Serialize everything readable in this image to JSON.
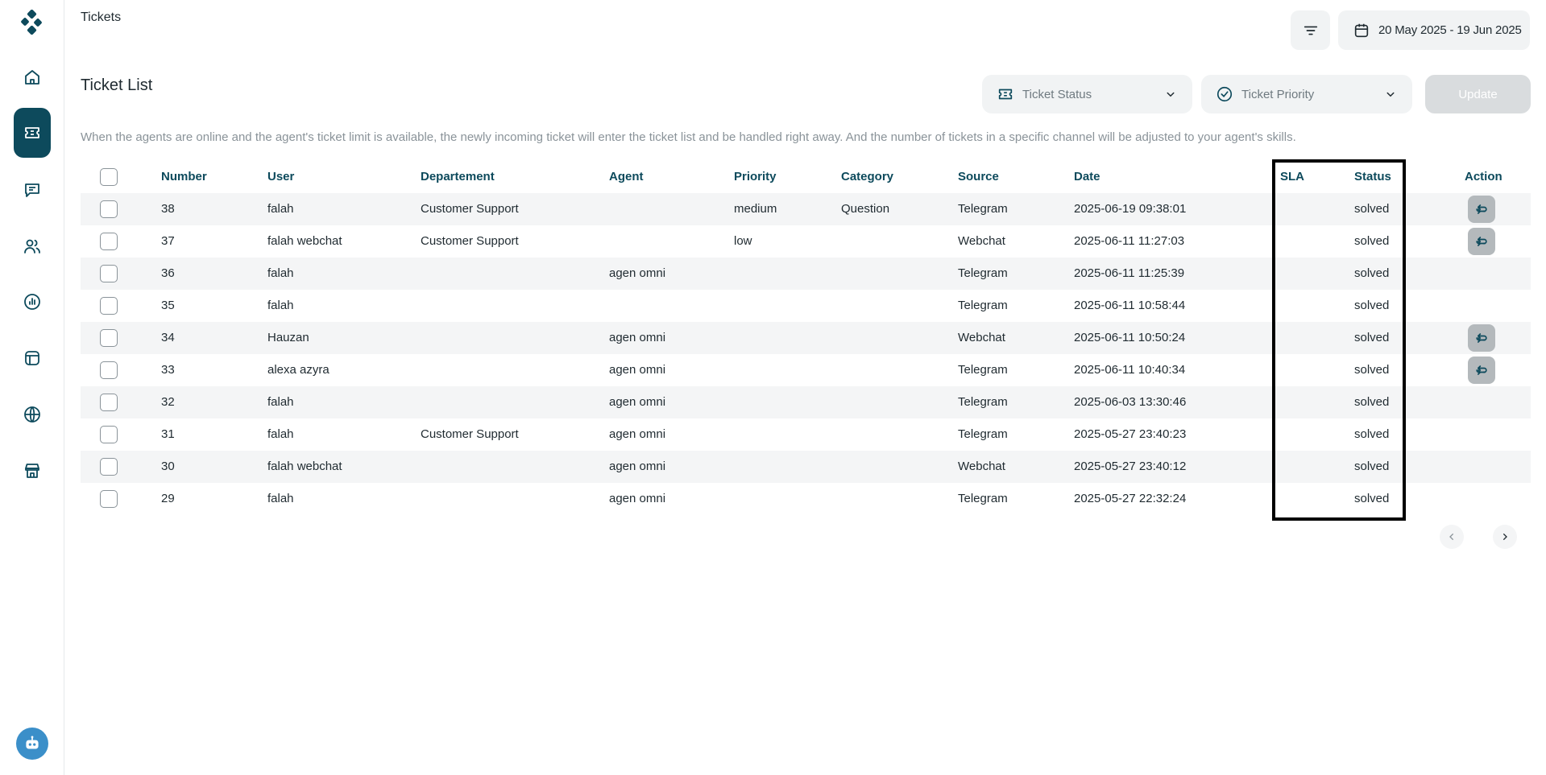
{
  "header": {
    "title": "Tickets",
    "date_range": "20 May 2025 - 19 Jun 2025"
  },
  "toolbar": {
    "list_title": "Ticket List",
    "status_placeholder": "Ticket Status",
    "priority_placeholder": "Ticket Priority",
    "update_label": "Update"
  },
  "description": "When the agents are online and the agent's ticket limit is available, the newly incoming ticket will enter the ticket list and be handled right away. And the number of tickets in a specific channel will be adjusted to your agent's skills.",
  "table": {
    "columns": {
      "number": "Number",
      "user": "User",
      "department": "Departement",
      "agent": "Agent",
      "priority": "Priority",
      "category": "Category",
      "source": "Source",
      "date": "Date",
      "sla": "SLA",
      "status": "Status",
      "action": "Action"
    },
    "rows": [
      {
        "number": "38",
        "user": "falah",
        "department": "Customer Support",
        "agent": "",
        "priority": "medium",
        "category": "Question",
        "source": "Telegram",
        "date": "2025-06-19 09:38:01",
        "sla": "",
        "status": "solved",
        "action": true
      },
      {
        "number": "37",
        "user": "falah webchat",
        "department": "Customer Support",
        "agent": "",
        "priority": "low",
        "category": "",
        "source": "Webchat",
        "date": "2025-06-11 11:27:03",
        "sla": "",
        "status": "solved",
        "action": true
      },
      {
        "number": "36",
        "user": "falah",
        "department": "",
        "agent": "agen omni",
        "priority": "",
        "category": "",
        "source": "Telegram",
        "date": "2025-06-11 11:25:39",
        "sla": "",
        "status": "solved",
        "action": false
      },
      {
        "number": "35",
        "user": "falah",
        "department": "",
        "agent": "",
        "priority": "",
        "category": "",
        "source": "Telegram",
        "date": "2025-06-11 10:58:44",
        "sla": "",
        "status": "solved",
        "action": false
      },
      {
        "number": "34",
        "user": "Hauzan",
        "department": "",
        "agent": "agen omni",
        "priority": "",
        "category": "",
        "source": "Webchat",
        "date": "2025-06-11 10:50:24",
        "sla": "",
        "status": "solved",
        "action": true
      },
      {
        "number": "33",
        "user": "alexa azyra",
        "department": "",
        "agent": "agen omni",
        "priority": "",
        "category": "",
        "source": "Telegram",
        "date": "2025-06-11 10:40:34",
        "sla": "",
        "status": "solved",
        "action": true
      },
      {
        "number": "32",
        "user": "falah",
        "department": "",
        "agent": "agen omni",
        "priority": "",
        "category": "",
        "source": "Telegram",
        "date": "2025-06-03 13:30:46",
        "sla": "",
        "status": "solved",
        "action": false
      },
      {
        "number": "31",
        "user": "falah",
        "department": "Customer Support",
        "agent": "agen omni",
        "priority": "",
        "category": "",
        "source": "Telegram",
        "date": "2025-05-27 23:40:23",
        "sla": "",
        "status": "solved",
        "action": false
      },
      {
        "number": "30",
        "user": "falah webchat",
        "department": "",
        "agent": "agen omni",
        "priority": "",
        "category": "",
        "source": "Webchat",
        "date": "2025-05-27 23:40:12",
        "sla": "",
        "status": "solved",
        "action": false
      },
      {
        "number": "29",
        "user": "falah",
        "department": "",
        "agent": "agen omni",
        "priority": "",
        "category": "",
        "source": "Telegram",
        "date": "2025-05-27 22:32:24",
        "sla": "",
        "status": "solved",
        "action": false
      }
    ]
  },
  "colors": {
    "accent": "#0d4a5c",
    "highlight_box": "#000000"
  },
  "icons": {
    "sidebar": [
      "home-icon",
      "ticket-icon",
      "chat-icon",
      "users-icon",
      "report-icon",
      "template-icon",
      "globe-icon",
      "store-icon"
    ]
  }
}
